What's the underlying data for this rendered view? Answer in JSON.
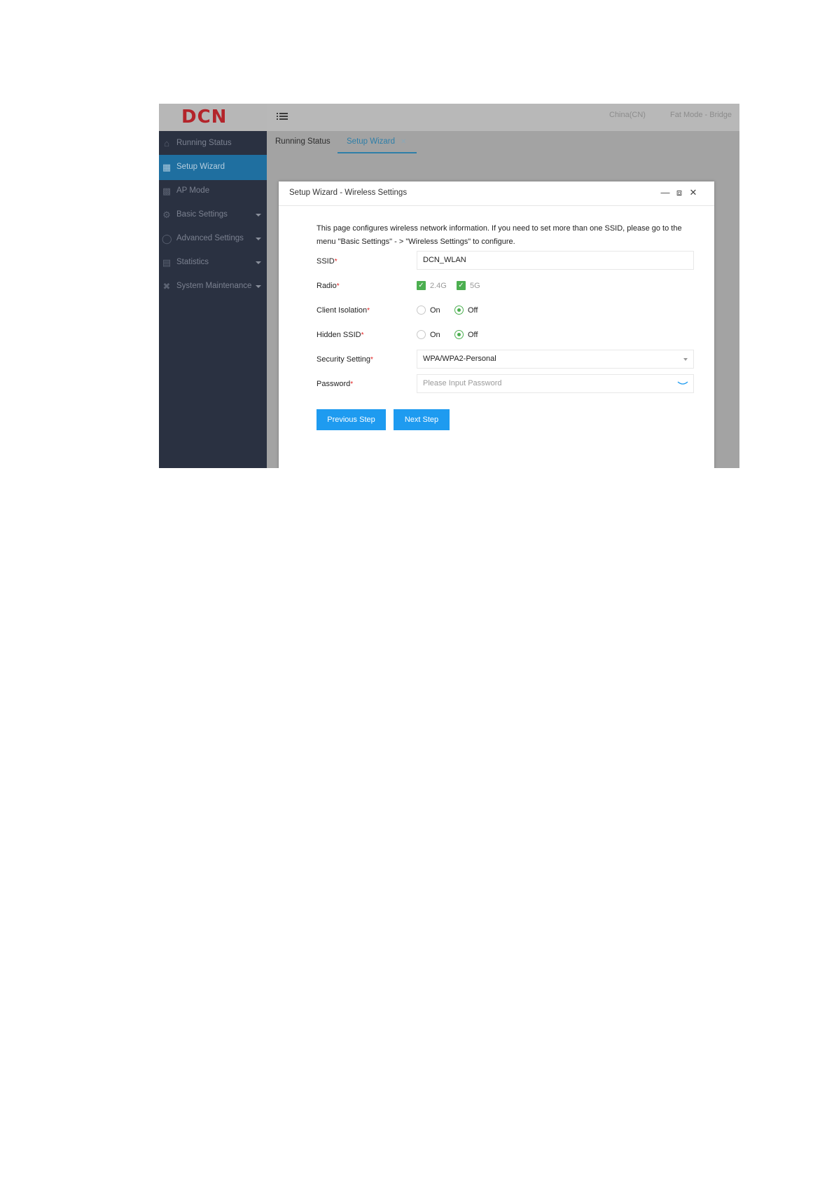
{
  "header": {
    "logo_text": "DCN",
    "region": "China(CN)",
    "mode": "Fat Mode - Bridge"
  },
  "sidebar": {
    "items": [
      {
        "label": "Running Status",
        "icon": "home-icon",
        "active": false,
        "has_submenu": false
      },
      {
        "label": "Setup Wizard",
        "icon": "wizard-icon",
        "active": true,
        "has_submenu": false
      },
      {
        "label": "AP Mode",
        "icon": "grid-icon",
        "active": false,
        "has_submenu": false
      },
      {
        "label": "Basic Settings",
        "icon": "gear-icon",
        "active": false,
        "has_submenu": true
      },
      {
        "label": "Advanced Settings",
        "icon": "circle-icon",
        "active": false,
        "has_submenu": true
      },
      {
        "label": "Statistics",
        "icon": "list-icon",
        "active": false,
        "has_submenu": true
      },
      {
        "label": "System Maintenance",
        "icon": "tools-icon",
        "active": false,
        "has_submenu": true
      }
    ]
  },
  "tabs": [
    {
      "label": "Running Status",
      "active": false
    },
    {
      "label": "Setup Wizard",
      "active": true,
      "closable": true
    }
  ],
  "dialog": {
    "title": "Setup Wizard - Wireless Settings",
    "description": "This page configures wireless network information. If you need to set more than one SSID, please go to the menu \"Basic Settings\" - > \"Wireless Settings\" to configure.",
    "required_mark": "*",
    "ssid": {
      "label": "SSID",
      "value": "DCN_WLAN"
    },
    "radio": {
      "label": "Radio",
      "options": [
        {
          "label": "2.4G",
          "checked": true
        },
        {
          "label": "5G",
          "checked": true
        }
      ]
    },
    "client_isolation": {
      "label": "Client Isolation",
      "options": [
        "On",
        "Off"
      ],
      "selected": "Off"
    },
    "hidden_ssid": {
      "label": "Hidden SSID",
      "options": [
        "On",
        "Off"
      ],
      "selected": "Off"
    },
    "security": {
      "label": "Security Setting",
      "value": "WPA/WPA2-Personal"
    },
    "password": {
      "label": "Password",
      "placeholder": "Please Input Password"
    },
    "buttons": {
      "previous": "Previous Step",
      "next": "Next Step"
    }
  },
  "colors": {
    "brand_red": "#b3242a",
    "sidebar_bg": "#2a3141",
    "sidebar_active": "#1f6fa0",
    "primary_button": "#1e9bf0",
    "check_green": "#4caf50",
    "required_red": "#e02020"
  }
}
